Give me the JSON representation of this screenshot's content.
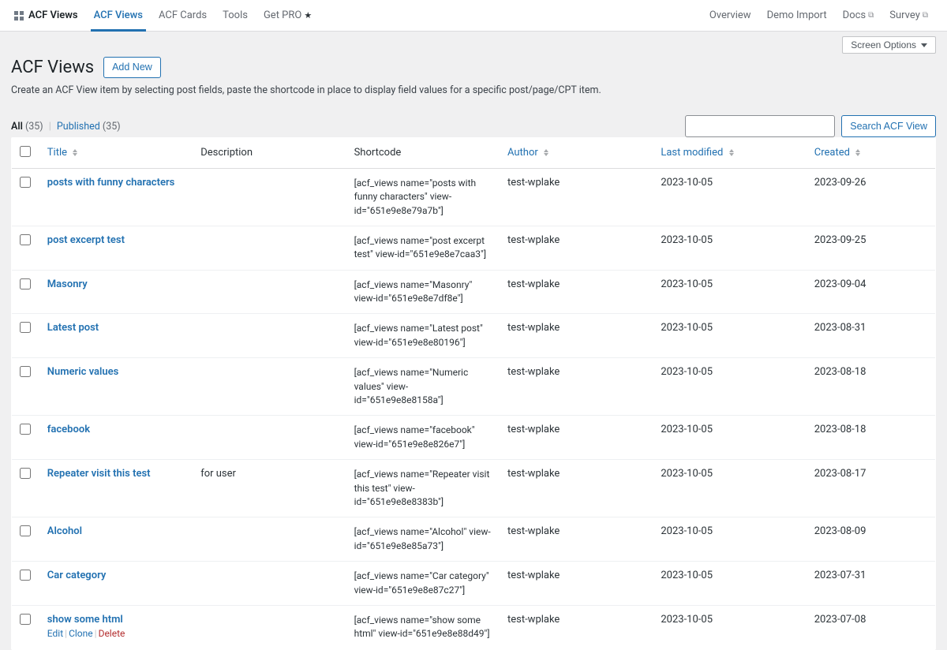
{
  "nav": {
    "logo": "ACF Views",
    "tabs": [
      {
        "label": "ACF Views",
        "active": true
      },
      {
        "label": "ACF Cards",
        "active": false
      },
      {
        "label": "Tools",
        "active": false
      },
      {
        "label": "Get PRO",
        "active": false,
        "star": true
      }
    ],
    "right": [
      {
        "label": "Overview"
      },
      {
        "label": "Demo Import"
      },
      {
        "label": "Docs",
        "ext": true
      },
      {
        "label": "Survey",
        "ext": true
      }
    ]
  },
  "screen_options_label": "Screen Options",
  "page_title": "ACF Views",
  "add_new_label": "Add New",
  "sub_description": "Create an ACF View item by selecting post fields, paste the shortcode in place to display field values for a specific post/page/CPT item.",
  "filters": {
    "all_label": "All",
    "all_count": "(35)",
    "published_label": "Published",
    "published_count": "(35)"
  },
  "search_button": "Search ACF View",
  "columns": {
    "title": "Title",
    "description": "Description",
    "shortcode": "Shortcode",
    "author": "Author",
    "last_modified": "Last modified",
    "created": "Created"
  },
  "row_actions": {
    "edit": "Edit",
    "clone": "Clone",
    "delete": "Delete"
  },
  "rows": [
    {
      "title": "posts with funny characters",
      "description": "",
      "shortcode": "[acf_views name=\"posts with funny characters\" view-id=\"651e9e8e79a7b\"]",
      "author": "test-wplake",
      "last_modified": "2023-10-05",
      "created": "2023-09-26"
    },
    {
      "title": "post excerpt test",
      "description": "",
      "shortcode": "[acf_views name=\"post excerpt test\" view-id=\"651e9e8e7caa3\"]",
      "author": "test-wplake",
      "last_modified": "2023-10-05",
      "created": "2023-09-25"
    },
    {
      "title": "Masonry",
      "description": "",
      "shortcode": "[acf_views name=\"Masonry\" view-id=\"651e9e8e7df8e\"]",
      "author": "test-wplake",
      "last_modified": "2023-10-05",
      "created": "2023-09-04"
    },
    {
      "title": "Latest post",
      "description": "",
      "shortcode": "[acf_views name=\"Latest post\" view-id=\"651e9e8e80196\"]",
      "author": "test-wplake",
      "last_modified": "2023-10-05",
      "created": "2023-08-31"
    },
    {
      "title": "Numeric values",
      "description": "",
      "shortcode": "[acf_views name=\"Numeric values\" view-id=\"651e9e8e8158a\"]",
      "author": "test-wplake",
      "last_modified": "2023-10-05",
      "created": "2023-08-18"
    },
    {
      "title": "facebook",
      "description": "",
      "shortcode": "[acf_views name=\"facebook\" view-id=\"651e9e8e826e7\"]",
      "author": "test-wplake",
      "last_modified": "2023-10-05",
      "created": "2023-08-18"
    },
    {
      "title": "Repeater visit this test",
      "description": "for user",
      "shortcode": "[acf_views name=\"Repeater visit this test\" view-id=\"651e9e8e8383b\"]",
      "author": "test-wplake",
      "last_modified": "2023-10-05",
      "created": "2023-08-17"
    },
    {
      "title": "Alcohol",
      "description": "",
      "shortcode": "[acf_views name=\"Alcohol\" view-id=\"651e9e8e85a73\"]",
      "author": "test-wplake",
      "last_modified": "2023-10-05",
      "created": "2023-08-09"
    },
    {
      "title": "Car category",
      "description": "",
      "shortcode": "[acf_views name=\"Car category\" view-id=\"651e9e8e87c27\"]",
      "author": "test-wplake",
      "last_modified": "2023-10-05",
      "created": "2023-07-31"
    },
    {
      "title": "show some html",
      "description": "",
      "shortcode": "[acf_views name=\"show some html\" view-id=\"651e9e8e88d49\"]",
      "author": "test-wplake",
      "last_modified": "2023-10-05",
      "created": "2023-07-08",
      "row_actions": true
    }
  ]
}
